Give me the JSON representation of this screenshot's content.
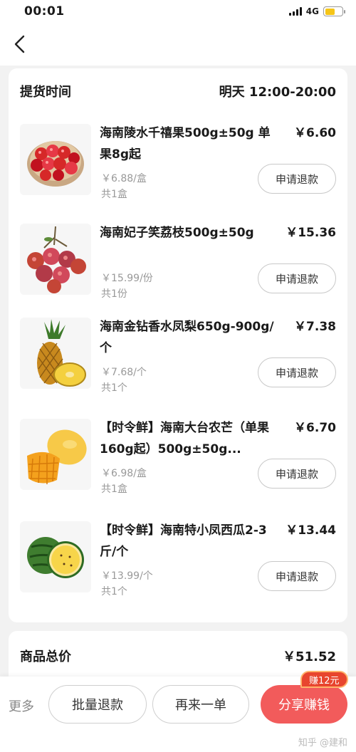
{
  "status_bar": {
    "time": "00:01",
    "network": "4G"
  },
  "pickup": {
    "label": "提货时间",
    "value": "明天 12:00-20:00"
  },
  "items": [
    {
      "name": "海南陵水千禧果500g±50g 单果8g起",
      "price": "￥6.60",
      "original_price": "￥6.88/盒",
      "quantity": "共1盒",
      "refund_label": "申请退款",
      "image": "cherry-tomatoes"
    },
    {
      "name": "海南妃子笑荔枝500g±50g",
      "price": "￥15.36",
      "original_price": "￥15.99/份",
      "quantity": "共1份",
      "refund_label": "申请退款",
      "image": "lychees"
    },
    {
      "name": "海南金钻香水凤梨650g-900g/个",
      "price": "￥7.38",
      "original_price": "￥7.68/个",
      "quantity": "共1个",
      "refund_label": "申请退款",
      "image": "pineapple"
    },
    {
      "name": "【时令鲜】海南大台农芒（单果160g起）500g±50g...",
      "price": "￥6.70",
      "original_price": "￥6.98/盒",
      "quantity": "共1盒",
      "refund_label": "申请退款",
      "image": "mango"
    },
    {
      "name": "【时令鲜】海南特小凤西瓜2-3斤/个",
      "price": "￥13.44",
      "original_price": "￥13.99/个",
      "quantity": "共1个",
      "refund_label": "申请退款",
      "image": "watermelon"
    }
  ],
  "total": {
    "label": "商品总价",
    "value": "￥51.52"
  },
  "bottom_bar": {
    "more": "更多",
    "batch_refund": "批量退款",
    "reorder": "再来一单",
    "share": "分享赚钱",
    "earn_badge": "赚12元"
  },
  "watermark": "知乎 @建和",
  "colors": {
    "accent": "#f25b5b",
    "badge": "#e8452e",
    "muted": "#999999"
  }
}
